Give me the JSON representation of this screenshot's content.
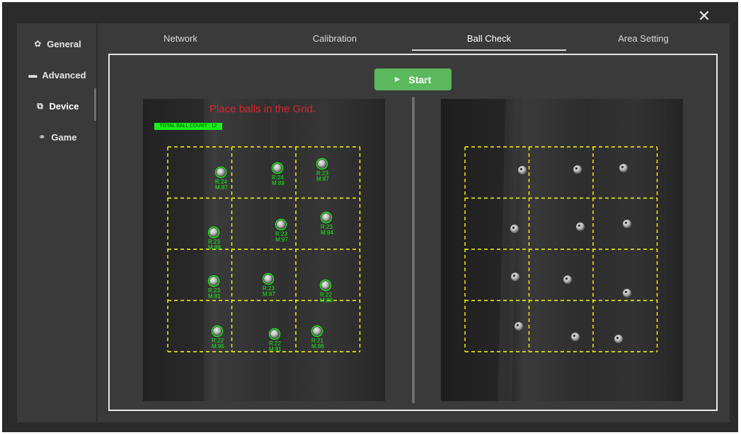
{
  "window": {
    "close_icon": "close-icon"
  },
  "sidebar": {
    "items": [
      {
        "label": "General",
        "icon": "gear-icon",
        "glyph": "✿"
      },
      {
        "label": "Advanced",
        "icon": "keyboard-icon",
        "glyph": "▬"
      },
      {
        "label": "Device",
        "icon": "device-icon",
        "glyph": "⧉"
      },
      {
        "label": "Game",
        "icon": "gamepad-icon",
        "glyph": "⚭"
      }
    ],
    "active": "Device"
  },
  "tabs": [
    {
      "label": "Network"
    },
    {
      "label": "Calibration"
    },
    {
      "label": "Ball Check"
    },
    {
      "label": "Area Setting"
    }
  ],
  "active_tab": "Ball Check",
  "start_button": {
    "label": "Start"
  },
  "left_camera": {
    "instruction": "Place balls in the Grid.",
    "ball_count_label": "TOTAL BALL COUNT : 12",
    "detections": [
      {
        "r": "R:24",
        "m": "M:87"
      },
      {
        "r": "R:24",
        "m": "M:89"
      },
      {
        "r": "R:23",
        "m": "M:87"
      },
      {
        "r": "R:23",
        "m": "M:88"
      },
      {
        "r": "R:23",
        "m": "M:97"
      },
      {
        "r": "R:23",
        "m": "M:94"
      },
      {
        "r": "R:23",
        "m": "M:81"
      },
      {
        "r": "R:23",
        "m": "M:87"
      },
      {
        "r": "R:22",
        "m": "M:89"
      },
      {
        "r": "R:22",
        "m": "M:96"
      },
      {
        "r": "R:22",
        "m": "M:81"
      },
      {
        "r": "R:21",
        "m": "M:86"
      }
    ]
  },
  "colors": {
    "accent_green": "#5cb85c",
    "grid_yellow": "#ffff00",
    "detect_green": "#19f019",
    "instruction_red": "#e0242c"
  }
}
